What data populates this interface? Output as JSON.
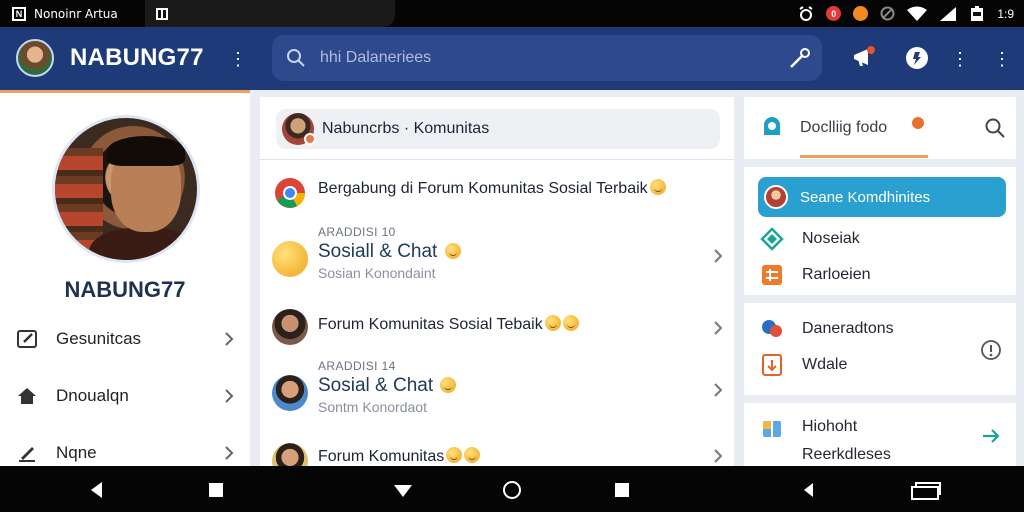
{
  "status_bar": {
    "app_title": "Nonoinr Artua",
    "time": "1:9",
    "indicators": [
      "alarm-icon",
      "notification-red-icon",
      "notification-orange-icon",
      "blocked-icon",
      "wifi-icon",
      "signal-icon",
      "battery-icon"
    ]
  },
  "app_bar": {
    "title": "NABUNG77",
    "search_placeholder": "hhi Dalaneriees",
    "colors": {
      "background": "#1f3a78",
      "search": "#2d4a8c"
    }
  },
  "sidebar": {
    "profile_name": "NABUNG77",
    "items": [
      {
        "label": "Gesunitcas",
        "icon": "edit-icon"
      },
      {
        "label": "Dnoualqn",
        "icon": "home-icon"
      },
      {
        "label": "Nqne",
        "icon": "pen-icon"
      }
    ]
  },
  "feed": {
    "compose_text": "Nabuncrbs · Komunitas",
    "rows": [
      {
        "title": "Bergabung di Forum Komunitas Sosial Terbaik",
        "icon": "chrome-icon",
        "has_emoji": true
      },
      {
        "kicker": "ARADDISI 10",
        "title": "Sosiall & Chat",
        "subtitle": "Sosian Konondaint",
        "icon": "emoji-avatar"
      },
      {
        "title": "Forum Komunitas Sosial Tebaik",
        "icon": "user-avatar"
      },
      {
        "kicker": "ARADDISI 14",
        "title": "Sosial & Chat",
        "subtitle": "Sontm Konordaot",
        "icon": "user-avatar"
      },
      {
        "title": "Forum Komunitas",
        "icon": "user-avatar"
      }
    ]
  },
  "right_panel": {
    "tab_label": "Doclliig fodo",
    "section1": [
      {
        "label": "Seane Komdhinites",
        "icon": "avatar-icon",
        "selected": true
      },
      {
        "label": "Noseiak",
        "icon": "diamond-icon"
      },
      {
        "label": "Rarloeien",
        "icon": "grid-icon"
      }
    ],
    "section2": [
      {
        "label": "Daneradtons",
        "icon": "chat-bubbles-icon"
      },
      {
        "label": "Wdale",
        "icon": "document-icon"
      }
    ],
    "section3": [
      {
        "label": "Hiohoht",
        "icon": "gift-icon"
      },
      {
        "label": "Reerkdleses"
      }
    ]
  }
}
